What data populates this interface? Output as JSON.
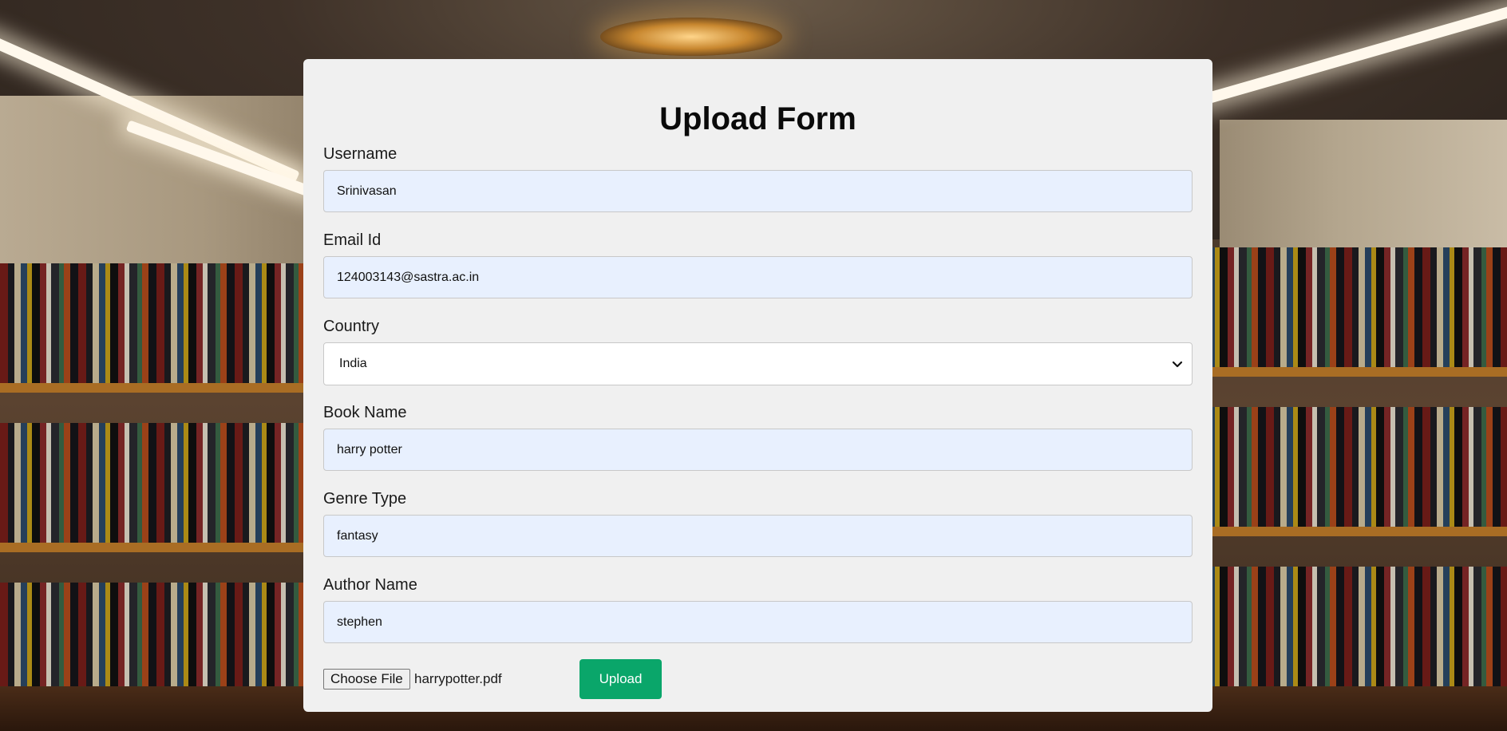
{
  "form": {
    "title": "Upload Form",
    "fields": {
      "username": {
        "label": "Username",
        "value": "Srinivasan"
      },
      "email": {
        "label": "Email Id",
        "value": "124003143@sastra.ac.in"
      },
      "country": {
        "label": "Country",
        "selected": "India"
      },
      "book_name": {
        "label": "Book Name",
        "value": "harry potter"
      },
      "genre": {
        "label": "Genre Type",
        "value": "fantasy"
      },
      "author": {
        "label": "Author Name",
        "value": "stephen"
      }
    },
    "file": {
      "button_label": "Choose File",
      "file_name": "harrypotter.pdf"
    },
    "submit_label": "Upload"
  },
  "colors": {
    "card_bg": "#f0f0f0",
    "input_bg": "#e8f0fe",
    "submit_bg": "#0aa66a"
  },
  "icons": {
    "select_arrow": "chevron-down-icon"
  }
}
